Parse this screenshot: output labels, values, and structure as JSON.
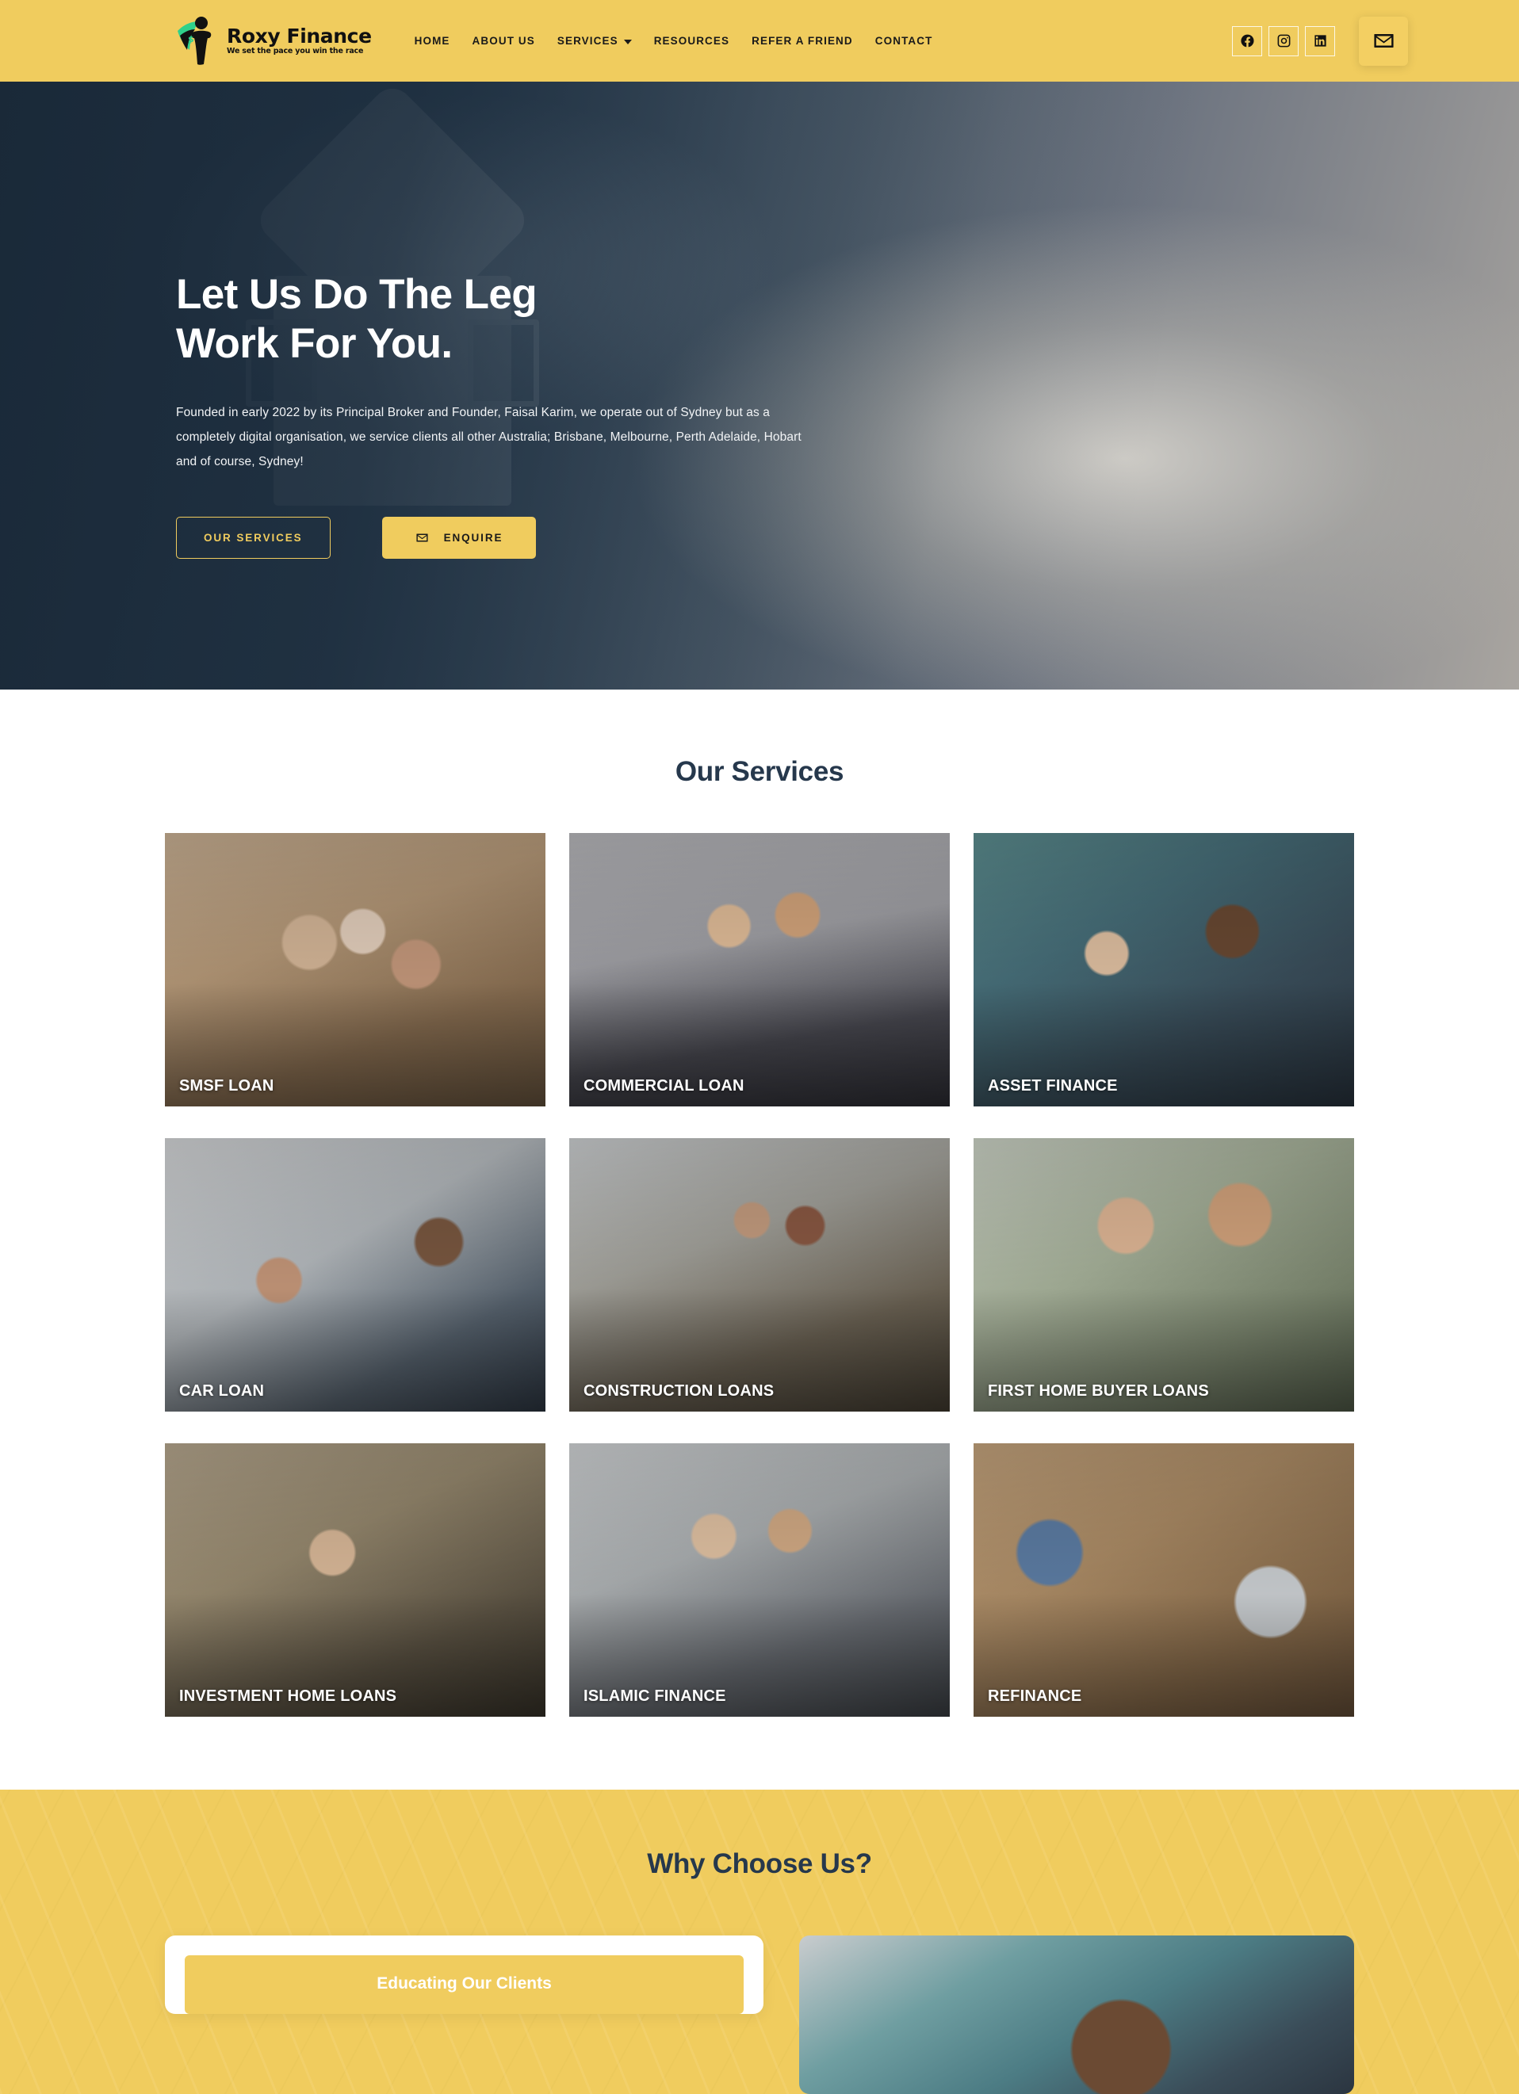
{
  "brand": {
    "name": "Roxy Finance",
    "tagline": "We set the pace you win the race",
    "accent_yellow": "#f0cc5e",
    "dark_navy": "#26384c"
  },
  "header": {
    "nav": [
      {
        "label": "HOME",
        "has_dropdown": false
      },
      {
        "label": "ABOUT US",
        "has_dropdown": false
      },
      {
        "label": "SERVICES",
        "has_dropdown": true
      },
      {
        "label": "RESOURCES",
        "has_dropdown": false
      },
      {
        "label": "REFER A FRIEND",
        "has_dropdown": false
      },
      {
        "label": "CONTACT",
        "has_dropdown": false
      }
    ],
    "social": [
      {
        "icon": "facebook-icon"
      },
      {
        "icon": "instagram-icon"
      },
      {
        "icon": "linkedin-icon"
      }
    ],
    "mail_button_icon": "envelope-icon"
  },
  "hero": {
    "title_line1": "Let Us Do The Leg",
    "title_line2": "Work For You.",
    "paragraph": "Founded in early 2022 by its Principal Broker and Founder, Faisal Karim, we operate out of Sydney but as a completely digital organisation, we service clients all other Australia; Brisbane, Melbourne, Perth Adelaide, Hobart and of course, Sydney!",
    "btn_services": "OUR SERVICES",
    "btn_enquire": "ENQUIRE"
  },
  "services": {
    "title": "Our Services",
    "cards": [
      {
        "label": "SMSF LOAN",
        "photo": "ph-smsf"
      },
      {
        "label": "COMMERCIAL LOAN",
        "photo": "ph-comm"
      },
      {
        "label": "ASSET FINANCE",
        "photo": "ph-asset"
      },
      {
        "label": "CAR LOAN",
        "photo": "ph-car"
      },
      {
        "label": "CONSTRUCTION LOANS",
        "photo": "ph-const"
      },
      {
        "label": "FIRST HOME BUYER LOANS",
        "photo": "ph-fhb"
      },
      {
        "label": "INVESTMENT HOME LOANS",
        "photo": "ph-inv"
      },
      {
        "label": "ISLAMIC FINANCE",
        "photo": "ph-islam"
      },
      {
        "label": "REFINANCE",
        "photo": "ph-refi"
      }
    ]
  },
  "why_choose": {
    "title": "Why Choose Us?",
    "card_banner": "Educating Our Clients"
  }
}
